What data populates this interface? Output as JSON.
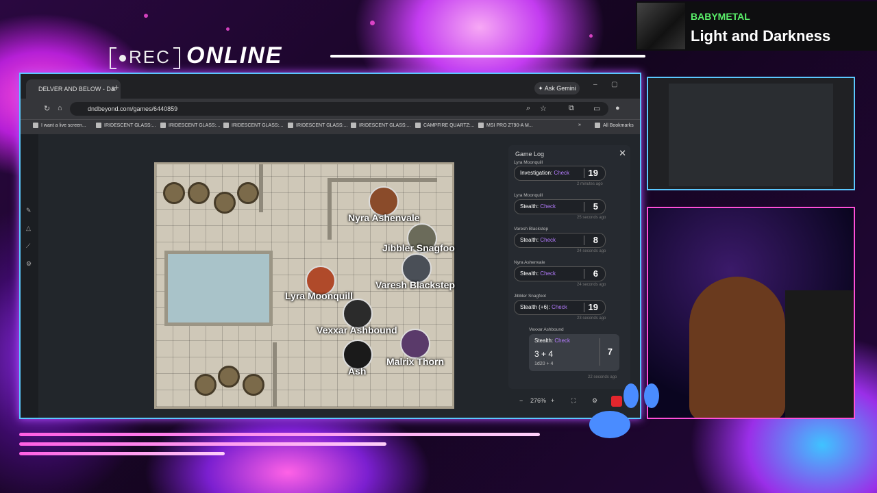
{
  "overlay": {
    "rec_label": "REC",
    "online_label": "ONLINE"
  },
  "now_playing": {
    "artist": "BABYMETAL",
    "title": "Light and Darkness"
  },
  "browser": {
    "tab_title": "DELVER AND BELOW - D&",
    "ask_gemini": "Ask Gemini",
    "url": "dndbeyond.com/games/6440859",
    "bookmarks": [
      "I want a live screen...",
      "IRIDESCENT GLASS:...",
      "IRIDESCENT GLASS:...",
      "IRIDESCENT GLASS:...",
      "IRIDESCENT GLASS:...",
      "IRIDESCENT GLASS:...",
      "CAMPFIRE QUARTZ:...",
      "MSI PRO Z790-A M..."
    ],
    "all_bookmarks": "All Bookmarks"
  },
  "map": {
    "tokens": [
      {
        "name": "Nyra Ashenvale",
        "color": "#8a4b2a"
      },
      {
        "name": "Jibbler Snagfoo",
        "color": "#6b6b5a"
      },
      {
        "name": "Varesh Blackstep",
        "color": "#4a4f57"
      },
      {
        "name": "Lyra Moonquill",
        "color": "#b04a2a"
      },
      {
        "name": "Vexxar Ashbound",
        "color": "#2b2b2b"
      },
      {
        "name": "Malrix Thorn",
        "color": "#5a3a6a"
      },
      {
        "name": "Ash",
        "color": "#1a1a1a"
      }
    ]
  },
  "game_log": {
    "title": "Game Log",
    "entries": [
      {
        "name": "Lyra Moonquill",
        "skill": "Investigation:",
        "check": "Check",
        "value": "19",
        "ago": "2 minutes ago"
      },
      {
        "name": "Lyra Moonquill",
        "skill": "Stealth:",
        "check": "Check",
        "value": "5",
        "ago": "25 seconds ago"
      },
      {
        "name": "Varesh Blackstep",
        "skill": "Stealth:",
        "check": "Check",
        "value": "8",
        "ago": "24 seconds ago"
      },
      {
        "name": "Nyra Ashenvale",
        "skill": "Stealth:",
        "check": "Check",
        "value": "6",
        "ago": "24 seconds ago"
      },
      {
        "name": "Jibbler Snagfoot",
        "skill": "Stealth (+6):",
        "check": "Check",
        "value": "19",
        "ago": "23 seconds ago"
      }
    ],
    "latest": {
      "name": "Vexxar Ashbound",
      "skill": "Stealth:",
      "check": "Check",
      "dice": "3 + 4",
      "formula": "1d20 + 4",
      "total": "7",
      "ago": "22 seconds ago"
    },
    "zoom": "276%"
  }
}
